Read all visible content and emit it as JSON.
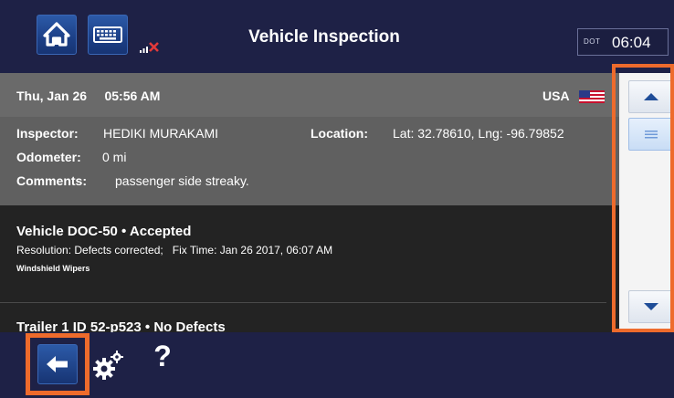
{
  "header": {
    "title": "Vehicle Inspection",
    "dot_label": "DOT",
    "time": "06:04",
    "icons": [
      "home-icon",
      "keyboard-icon",
      "no-signal-icon"
    ]
  },
  "inspection": {
    "date": "Thu, Jan 26",
    "time": "05:56 AM",
    "country": "USA",
    "inspector_label": "Inspector:",
    "inspector": "HEDIKI MURAKAMI",
    "location_label": "Location:",
    "location": "Lat: 32.78610, Lng: -96.79852",
    "odometer_label": "Odometer:",
    "odometer": "0 mi",
    "comments_label": "Comments:",
    "comments": "passenger side streaky."
  },
  "vehicle": {
    "title": "Vehicle DOC-50 • Accepted",
    "resolution": "Resolution: Defects corrected;   Fix Time: Jan 26 2017, 06:07 AM",
    "defect": "Windshield Wipers"
  },
  "trailer": {
    "title": "Trailer 1 ID 52-p523 • No Defects"
  },
  "footer": {
    "help_label": "?",
    "icons": [
      "back-arrow-icon",
      "settings-gear-icon",
      "help-icon"
    ]
  },
  "colors": {
    "header_bg": "#1e2146",
    "button_blue": "#1c3f86",
    "highlight_orange": "#ee6b2c",
    "summary_bg": "#606060",
    "detail_bg": "#232323"
  }
}
